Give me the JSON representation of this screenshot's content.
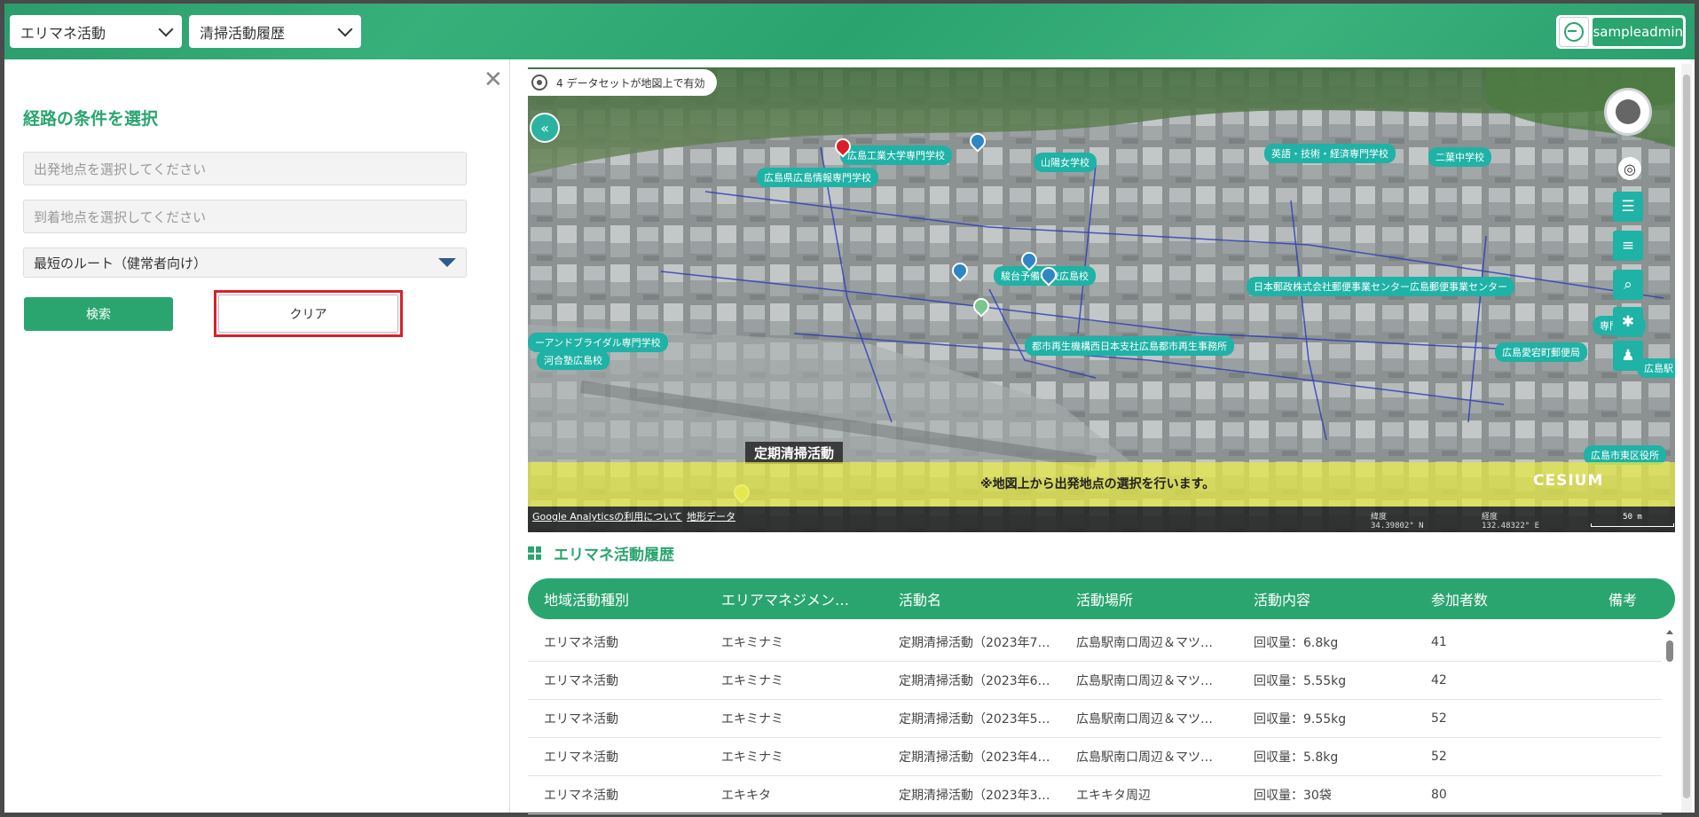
{
  "header": {
    "select1": "エリマネ活動",
    "select2": "清掃活動履歴",
    "username": "sampleadmin"
  },
  "left_panel": {
    "title": "経路の条件を選択",
    "origin_placeholder": "出発地点を選択してください",
    "destination_placeholder": "到着地点を選択してください",
    "route_type": "最短のルート（健常者向け）",
    "search_button": "検索",
    "clear_button": "クリア"
  },
  "map": {
    "dataset_status": "4 データセットが地図上で有効",
    "notice": "※地図上から出発地点の選択を行います。",
    "analytics_link": "Google Analyticsの利用について",
    "terrain_link": "地形データ",
    "lat_label": "緯度",
    "lat_value": "34.39802° N",
    "lon_label": "経度",
    "lon_value": "132.48322° E",
    "scale": "50 m",
    "cesium": "CESIUM",
    "big_label": "定期清掃活動",
    "labels": [
      "広島県広島情報専門学校",
      "広島工業大学専門学校",
      "山陽女学校",
      "英語・技術・経済専門学校",
      "二葉中学校",
      "駿台予備学校広島校",
      "日本郵政株式会社郵便事業センター広島郵便事業センター",
      "都市再生機構西日本支社広島都市再生事務所",
      "ーアンドブライダル専門学校",
      "河合塾広島校",
      "広島愛宕町郵便局",
      "広島市東区役所",
      "広島駅",
      "専門学校"
    ]
  },
  "table": {
    "title": "エリマネ活動履歴",
    "columns": [
      "地域活動種別",
      "エリアマネジメン…",
      "活動名",
      "活動場所",
      "活動内容",
      "参加者数",
      "備考"
    ],
    "rows": [
      [
        "エリマネ活動",
        "エキミナミ",
        "定期清掃活動（2023年7…",
        "広島駅南口周辺＆マツ…",
        "回収量：6.8kg",
        "41",
        ""
      ],
      [
        "エリマネ活動",
        "エキミナミ",
        "定期清掃活動（2023年6…",
        "広島駅南口周辺＆マツ…",
        "回収量：5.55kg",
        "42",
        ""
      ],
      [
        "エリマネ活動",
        "エキミナミ",
        "定期清掃活動（2023年5…",
        "広島駅南口周辺＆マツ…",
        "回収量：9.55kg",
        "52",
        ""
      ],
      [
        "エリマネ活動",
        "エキミナミ",
        "定期清掃活動（2023年4…",
        "広島駅南口周辺＆マツ…",
        "回収量：5.8kg",
        "52",
        ""
      ],
      [
        "エリマネ活動",
        "エキキタ",
        "定期清掃活動（2023年3…",
        "エキキタ周辺",
        "回収量：30袋",
        "80",
        ""
      ]
    ]
  },
  "colors": {
    "brand": "#2aa56f",
    "highlight": "#d9202a",
    "map_label": "#1fb2a6"
  }
}
